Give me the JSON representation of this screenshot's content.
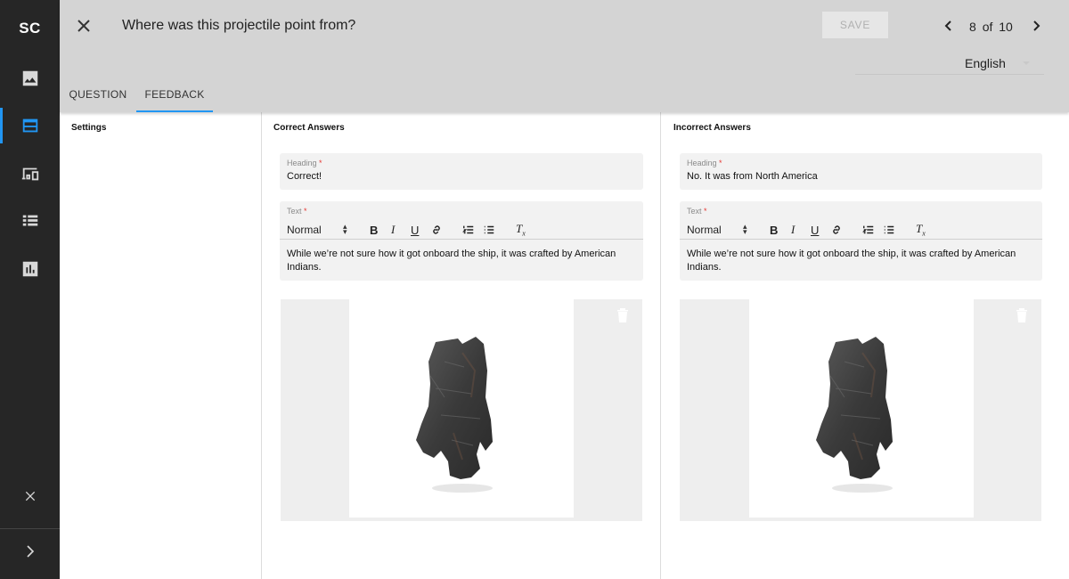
{
  "rail": {
    "logo": "SC",
    "items": [
      {
        "name": "image-icon"
      },
      {
        "name": "web-layout-icon"
      },
      {
        "name": "devices-icon"
      },
      {
        "name": "list-icon"
      },
      {
        "name": "chart-icon"
      }
    ],
    "accent_color": "#2196f3"
  },
  "header": {
    "title": "Where was this projectile point from?",
    "save_label": "SAVE",
    "pager": {
      "current": "8",
      "sep": "of",
      "total": "10"
    },
    "language": "English"
  },
  "tabs": [
    {
      "label": "QUESTION",
      "active": false
    },
    {
      "label": "FEEDBACK",
      "active": true
    }
  ],
  "settings": {
    "title": "Settings"
  },
  "correct": {
    "title": "Correct Answers",
    "heading_label": "Heading",
    "heading_value": "Correct!",
    "text_label": "Text",
    "format_select": "Normal",
    "text_value": "While we’re not sure how it got onboard the ship, it was crafted by American Indians."
  },
  "incorrect": {
    "title": "Incorrect Answers",
    "heading_label": "Heading",
    "heading_value": "No. It was from North America",
    "text_label": "Text",
    "format_select": "Normal",
    "text_value": "While we’re not sure how it got onboard the ship, it was crafted by American Indians."
  },
  "required_marker": "*"
}
